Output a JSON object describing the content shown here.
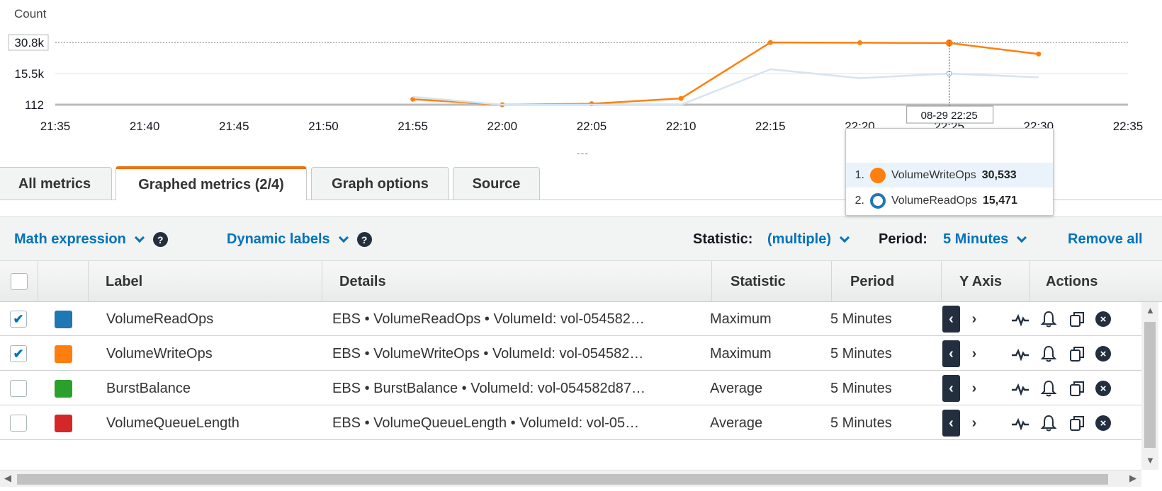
{
  "chart_data": {
    "type": "line",
    "ylabel": "Count",
    "y_ticks": [
      "30.8k",
      "15.5k",
      "112"
    ],
    "x": [
      "21:35",
      "21:40",
      "21:45",
      "21:50",
      "21:55",
      "22:00",
      "22:05",
      "22:10",
      "22:15",
      "22:20",
      "22:25",
      "22:30",
      "22:35"
    ],
    "ylim": [
      112,
      30800
    ],
    "series": [
      {
        "name": "VolumeWriteOps",
        "color": "#ff7f0e",
        "points": [
          {
            "x": "21:55",
            "y": 2800
          },
          {
            "x": "22:00",
            "y": 112
          },
          {
            "x": "22:05",
            "y": 600
          },
          {
            "x": "22:10",
            "y": 3200
          },
          {
            "x": "22:15",
            "y": 30800
          },
          {
            "x": "22:20",
            "y": 30650
          },
          {
            "x": "22:25",
            "y": 30533
          },
          {
            "x": "22:30",
            "y": 25100
          }
        ]
      },
      {
        "name": "VolumeReadOps",
        "color": "#1f77b4",
        "points": [
          {
            "x": "21:55",
            "y": 4000
          },
          {
            "x": "22:00",
            "y": 112
          },
          {
            "x": "22:05",
            "y": 112
          },
          {
            "x": "22:10",
            "y": 112
          },
          {
            "x": "22:15",
            "y": 17600
          },
          {
            "x": "22:20",
            "y": 13200
          },
          {
            "x": "22:25",
            "y": 15471
          },
          {
            "x": "22:30",
            "y": 13600
          }
        ]
      }
    ],
    "hover": {
      "x_label": "08-29 22:25",
      "items": [
        {
          "num": "1.",
          "name": "VolumeWriteOps",
          "value": "30,533",
          "color": "#ff7f0e",
          "filled": true
        },
        {
          "num": "2.",
          "name": "VolumeReadOps",
          "value": "15,471",
          "color": "#1f77b4",
          "filled": false
        }
      ]
    },
    "handle": "---"
  },
  "tabs": [
    "All metrics",
    "Graphed metrics (2/4)",
    "Graph options",
    "Source"
  ],
  "toolbar": {
    "math": "Math expression",
    "dynamic": "Dynamic labels",
    "help": "?",
    "statistic_label": "Statistic:",
    "statistic_value": "(multiple)",
    "period_label": "Period:",
    "period_value": "5 Minutes",
    "remove_all": "Remove all"
  },
  "table": {
    "headers": {
      "label": "Label",
      "details": "Details",
      "statistic": "Statistic",
      "period": "Period",
      "yaxis": "Y Axis",
      "actions": "Actions"
    },
    "rows": [
      {
        "checked": "✔",
        "color": "#1f77b4",
        "label": "VolumeReadOps",
        "details": "EBS • VolumeReadOps • VolumeId: vol-054582…",
        "statistic": "Maximum",
        "period": "5 Minutes",
        "left": "‹",
        "right": "›",
        "remove": "×"
      },
      {
        "checked": "✔",
        "color": "#ff7f0e",
        "label": "VolumeWriteOps",
        "details": "EBS • VolumeWriteOps • VolumeId: vol-054582…",
        "statistic": "Maximum",
        "period": "5 Minutes",
        "left": "‹",
        "right": "›",
        "remove": "×"
      },
      {
        "checked": "",
        "color": "#2ca02c",
        "label": "BurstBalance",
        "details": "EBS • BurstBalance • VolumeId: vol-054582d87…",
        "statistic": "Average",
        "period": "5 Minutes",
        "left": "‹",
        "right": "›",
        "remove": "×"
      },
      {
        "checked": "",
        "color": "#d62728",
        "label": "VolumeQueueLength",
        "details": "EBS • VolumeQueueLength • VolumeId: vol-05…",
        "statistic": "Average",
        "period": "5 Minutes",
        "left": "‹",
        "right": "›",
        "remove": "×"
      }
    ]
  },
  "scroll": {
    "up": "▲",
    "down": "▼",
    "left": "◀",
    "right": "▶"
  }
}
